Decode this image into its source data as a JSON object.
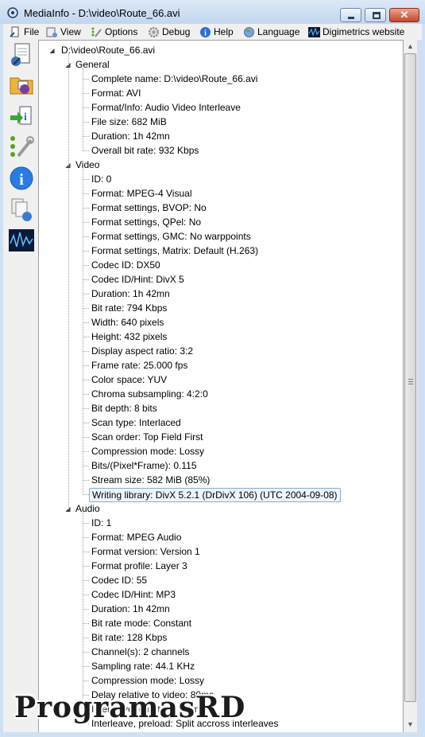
{
  "window": {
    "title": "MediaInfo - D:\\video\\Route_66.avi",
    "minimize": "minimize",
    "maximize": "maximize",
    "close": "✕"
  },
  "menu": [
    {
      "label": "File",
      "icon": "file-icon"
    },
    {
      "label": "View",
      "icon": "view-icon"
    },
    {
      "label": "Options",
      "icon": "options-icon"
    },
    {
      "label": "Debug",
      "icon": "debug-icon"
    },
    {
      "label": "Help",
      "icon": "help-icon"
    },
    {
      "label": "Language",
      "icon": "language-icon"
    },
    {
      "label": "Digimetrics website",
      "icon": "digimetrics-icon"
    }
  ],
  "sidebar": [
    "open-file-icon",
    "open-folder-icon",
    "export-icon",
    "preferences-icon",
    "about-icon",
    "knowledge-icon",
    "digimetrics-logo-icon"
  ],
  "tree": {
    "root": "D:\\video\\Route_66.avi",
    "sections": [
      {
        "name": "General",
        "items": [
          "Complete name: D:\\video\\Route_66.avi",
          "Format: AVI",
          "Format/Info: Audio Video Interleave",
          "File size: 682 MiB",
          "Duration: 1h 42mn",
          "Overall bit rate: 932 Kbps"
        ]
      },
      {
        "name": "Video",
        "items": [
          "ID: 0",
          "Format: MPEG-4 Visual",
          "Format settings, BVOP: No",
          "Format settings, QPel: No",
          "Format settings, GMC: No warppoints",
          "Format settings, Matrix: Default (H.263)",
          "Codec ID: DX50",
          "Codec ID/Hint: DivX 5",
          "Duration: 1h 42mn",
          "Bit rate: 794 Kbps",
          "Width: 640 pixels",
          "Height: 432 pixels",
          "Display aspect ratio: 3:2",
          "Frame rate: 25.000 fps",
          "Color space: YUV",
          "Chroma subsampling: 4:2:0",
          "Bit depth: 8 bits",
          "Scan type: Interlaced",
          "Scan order: Top Field First",
          "Compression mode: Lossy",
          "Bits/(Pixel*Frame): 0.115",
          "Stream size: 582 MiB (85%)",
          "Writing library: DivX 5.2.1 (DrDivX 106) (UTC 2004-09-08)"
        ]
      },
      {
        "name": "Audio",
        "items": [
          "ID: 1",
          "Format: MPEG Audio",
          "Format version: Version 1",
          "Format profile: Layer 3",
          "Codec ID: 55",
          "Codec ID/Hint: MP3",
          "Duration: 1h 42mn",
          "Bit rate mode: Constant",
          "Bit rate: 128 Kbps",
          "Channel(s): 2 channels",
          "Sampling rate: 44.1 KHz",
          "Compression mode: Lossy",
          "Delay relative to video: 80ms",
          "Interleave, duration: 12 ms",
          "Interleave, preload: Split accross interleaves"
        ]
      }
    ],
    "selected": "Writing library: DivX 5.2.1 (DrDivX 106) (UTC 2004-09-08)"
  },
  "scrollbar": {
    "up": "▲",
    "down": "▼",
    "position": 0.0
  },
  "watermark": "ProgramasRD"
}
